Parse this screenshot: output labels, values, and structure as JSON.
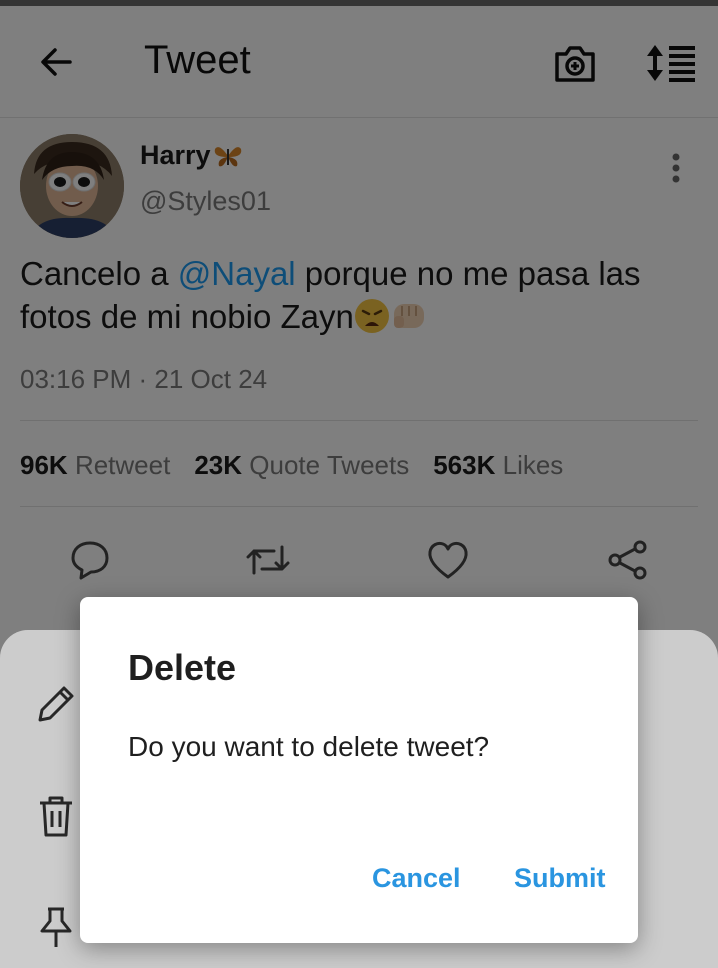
{
  "appbar": {
    "title": "Tweet"
  },
  "tweet": {
    "display_name": "Harry",
    "handle": "@Styles01",
    "text_before": "Cancelo a ",
    "mention": "@Nayal",
    "text_after_line1": " porque no me pasa las",
    "text_line2": "fotos de mi nobio Zayn",
    "timestamp": "03:16 PM · 21 Oct 24",
    "stats": {
      "retweet_count": "96K",
      "retweet_label": "Retweet",
      "quote_count": "23K",
      "quote_label": "Quote Tweets",
      "likes_count": "563K",
      "likes_label": "Likes"
    }
  },
  "dialog": {
    "title": "Delete",
    "message": "Do you want to delete tweet?",
    "cancel_label": "Cancel",
    "submit_label": "Submit"
  },
  "colors": {
    "mention": "#1d9bf0",
    "dialog_button": "#2a95e0"
  },
  "icons": {
    "back": "arrow-left-icon",
    "camera": "camera-plus-icon",
    "sort": "sort-list-icon",
    "more": "more-vertical-icon",
    "reply": "comment-icon",
    "retweet": "retweet-icon",
    "like": "heart-icon",
    "share": "share-icon",
    "edit": "pencil-icon",
    "delete": "trash-icon",
    "pin": "pin-icon"
  }
}
